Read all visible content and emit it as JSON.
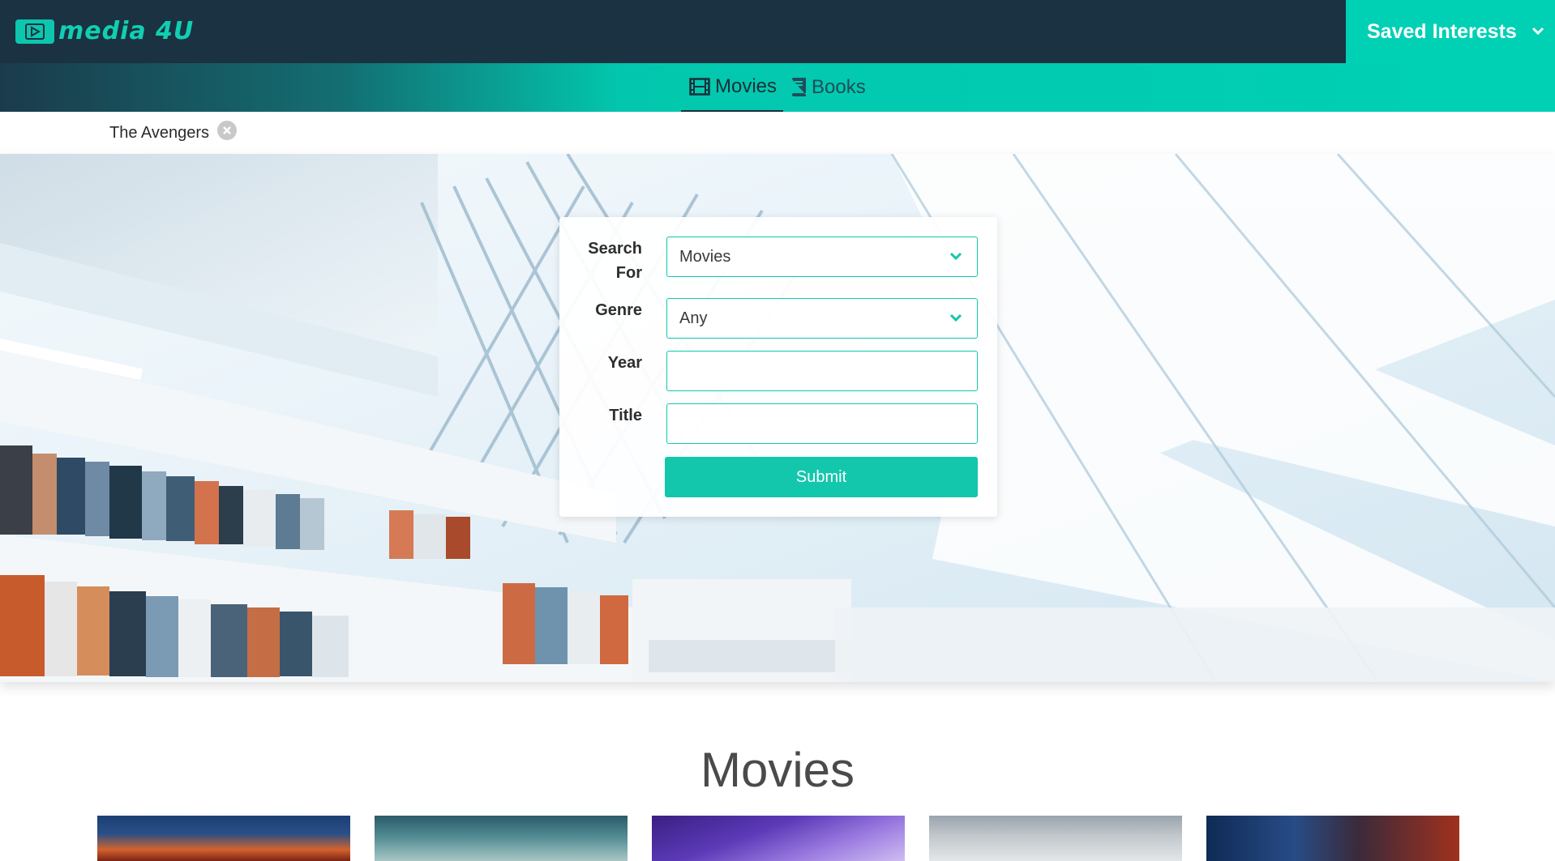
{
  "brand": {
    "logo_text": "media 4U",
    "accent": "#00d0b4",
    "dark": "#1b3242"
  },
  "header": {
    "saved_label": "Saved Interests",
    "saved_icon": "chevron-down-icon"
  },
  "nav": {
    "tabs": [
      {
        "label": "Movies",
        "icon": "film-icon",
        "active": true
      },
      {
        "label": "Books",
        "icon": "book-icon",
        "active": false
      }
    ]
  },
  "interests": [
    {
      "label": "The Avengers"
    }
  ],
  "search": {
    "search_for_label": "Search For",
    "search_for_value": "Movies",
    "genre_label": "Genre",
    "genre_value": "Any",
    "year_label": "Year",
    "year_value": "",
    "title_label": "Title",
    "title_value": "",
    "submit_label": "Submit"
  },
  "results": {
    "heading": "Movies",
    "posters": [
      "poster-1",
      "poster-2",
      "poster-3",
      "poster-4",
      "poster-5"
    ]
  }
}
